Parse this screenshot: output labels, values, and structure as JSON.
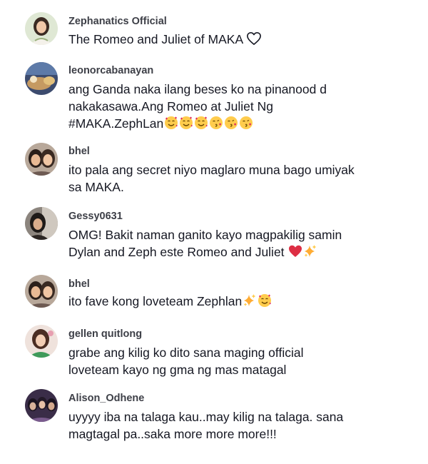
{
  "comments": [
    {
      "username": "Zephanatics Official",
      "lines": [
        "The Romeo and Juliet of MAKA"
      ],
      "avatar_color": "#c9d8b8"
    },
    {
      "username": "leonorcabanayan",
      "lines": [
        "ang Ganda naka ilang beses ko na pinanood d",
        "nakakasawa.Ang Romeo at Juliet Ng",
        "#MAKA.ZephLan"
      ],
      "emojis": [
        "smiling-face-with-hearts-icon",
        "smiling-face-with-hearts-icon",
        "smiling-face-with-hearts-icon",
        "face-blowing-kiss-icon",
        "face-blowing-kiss-icon",
        "face-blowing-kiss-icon"
      ],
      "avatar_color": "#5b6a88"
    },
    {
      "username": "bhel",
      "lines": [
        "ito pala ang secret niyo maglaro muna bago umiyak",
        "sa MAKA."
      ],
      "avatar_color": "#8a6a5c"
    },
    {
      "username": "Gessy0631",
      "lines": [
        "OMG! Bakit naman ganito kayo magpakilig samin",
        "Dylan and Zeph este Romeo and Juliet"
      ],
      "emojis": [
        "red-heart-icon",
        "sparkles-icon"
      ],
      "avatar_color": "#6f6862"
    },
    {
      "username": "bhel",
      "lines": [
        "ito fave kong loveteam Zephlan"
      ],
      "emojis": [
        "sparkles-icon",
        "smiling-face-with-hearts-icon"
      ],
      "avatar_color": "#8a6a5c"
    },
    {
      "username": "gellen quitlong",
      "lines": [
        "grabe ang kilig ko dito sana maging official",
        "loveteam kayo ng gma ng mas matagal"
      ],
      "avatar_color": "#c98e84"
    },
    {
      "username": "Alison_Odhene",
      "lines": [
        "uyyyy iba na talaga kau..may kilig na talaga. sana",
        "magtagal pa..saka more more more!!!"
      ],
      "avatar_color": "#4a3a5c"
    }
  ],
  "colors": {
    "username": "#3d3f47",
    "text": "#161823",
    "background": "#ffffff"
  }
}
